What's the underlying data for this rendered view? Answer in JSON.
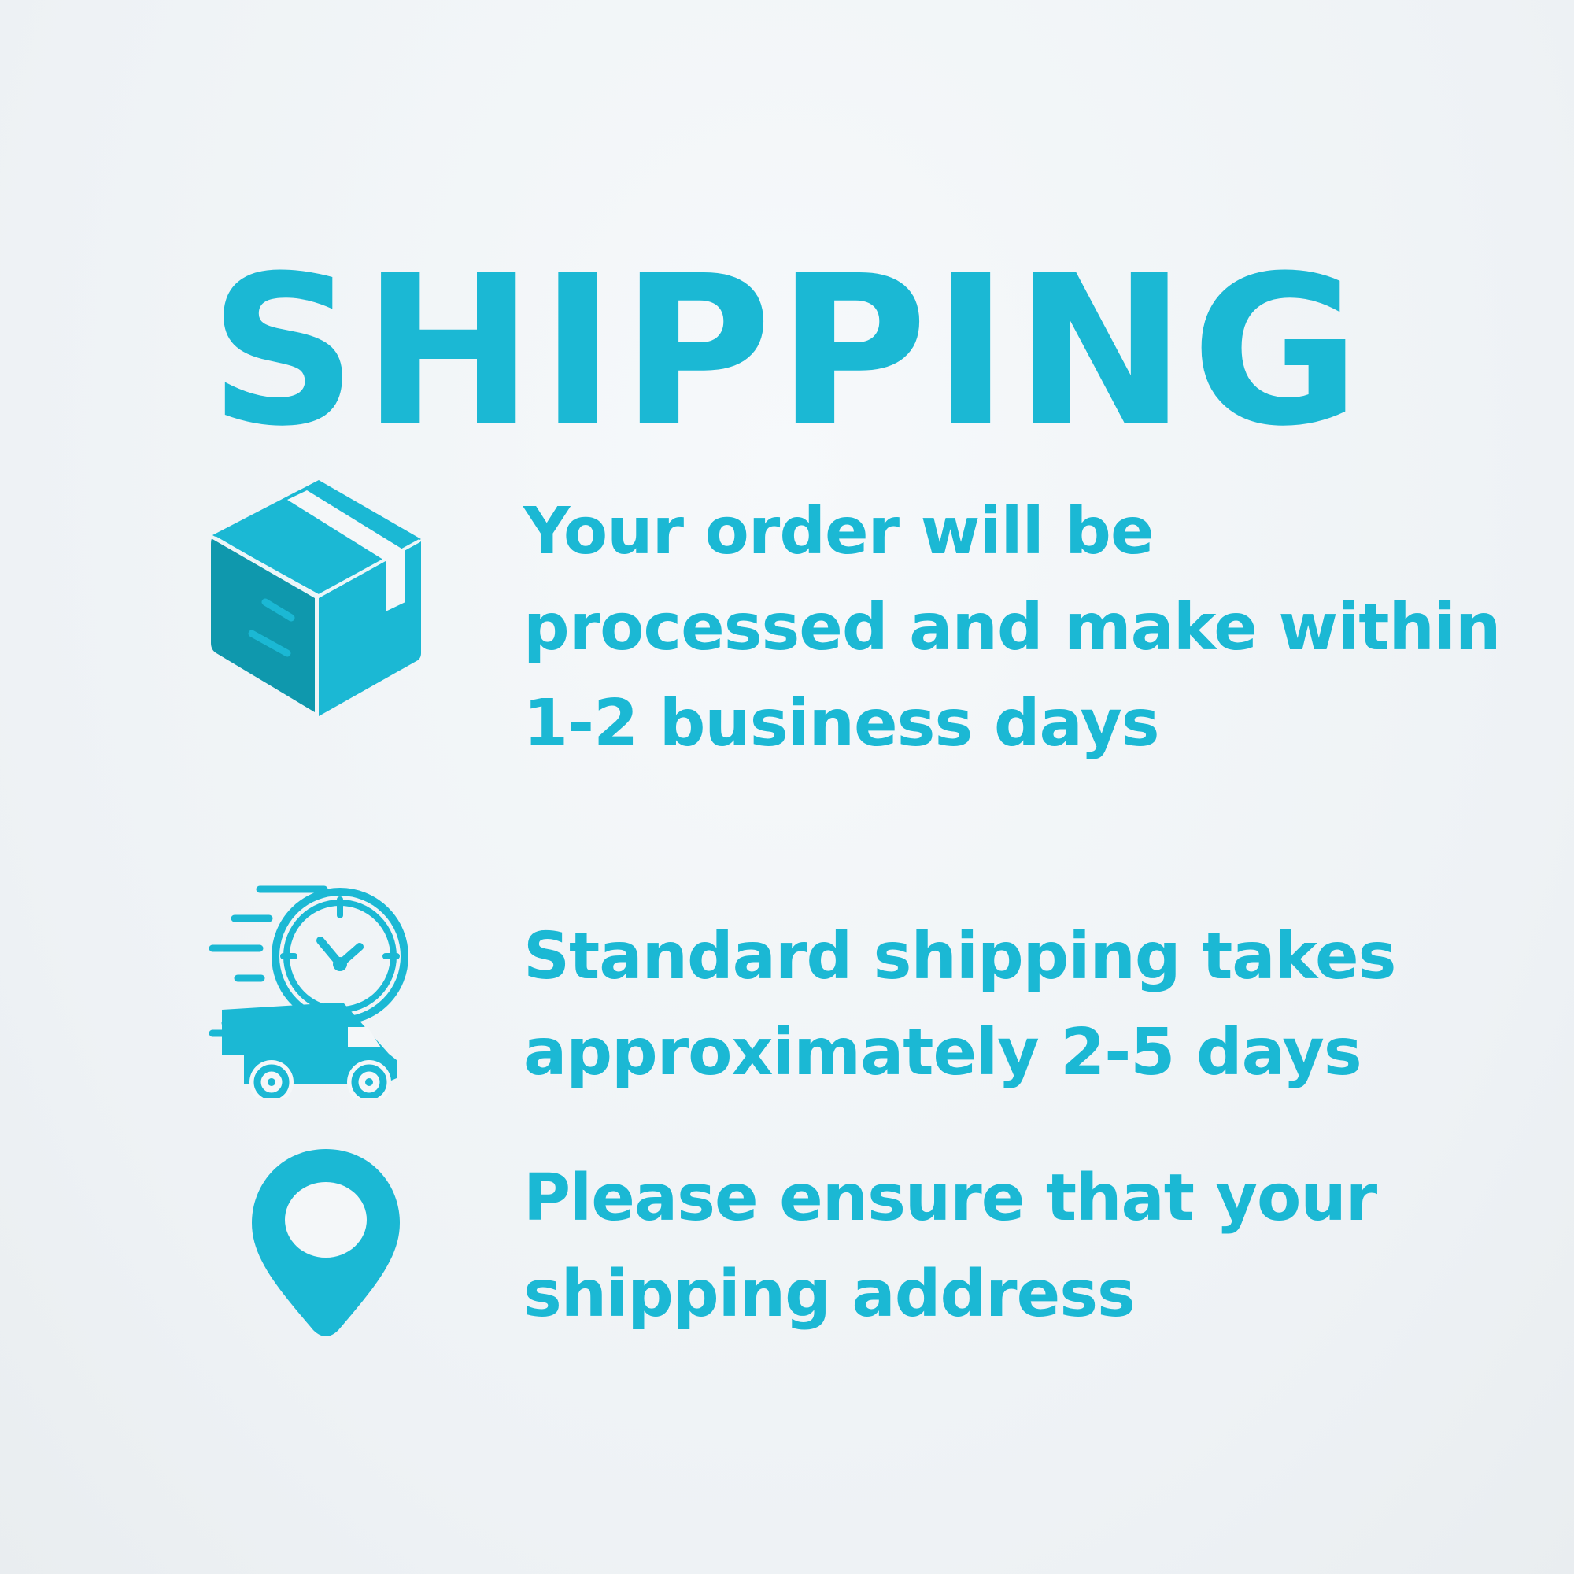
{
  "title": "SHIPPING",
  "accent_color": "#1bb8d4",
  "items": [
    {
      "icon": "package-box-icon",
      "text": "Your order will be processed and make within 1-2 business days"
    },
    {
      "icon": "fast-delivery-truck-clock-icon",
      "text": "Standard shipping takes approximately 2-5 days"
    },
    {
      "icon": "location-pin-icon",
      "text": "Please ensure that your shipping address"
    }
  ]
}
